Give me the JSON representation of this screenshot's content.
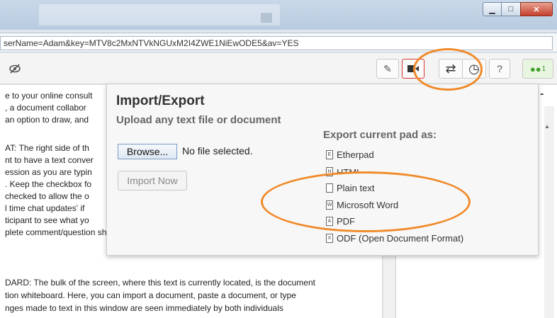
{
  "window": {
    "minimize_glyph": "▁",
    "maximize_glyph": "□",
    "close_glyph": "✕"
  },
  "address_bar": {
    "value": "serName=Adam&key=MTV8c2MxNTVkNGUxM2I4ZWE1NiEwODE5&av=YES"
  },
  "toolbar": {
    "left_icon": "eye-slash-icon",
    "buttons": [
      {
        "name": "pencil-icon",
        "glyph": "✎"
      },
      {
        "name": "video-icon",
        "glyph": "■"
      },
      {
        "name": "import-export-icon",
        "glyph": "⇄"
      },
      {
        "name": "history-icon",
        "glyph": "◷"
      },
      {
        "name": "help-icon",
        "glyph": "?"
      }
    ],
    "users": {
      "icon": "users-icon",
      "count": "1"
    }
  },
  "pad_lines": [
    "e to your online consult",
    ", a document collabor",
    "an option to draw, and",
    "",
    "AT: The right side of th",
    "nt to have a text conver",
    "ession as you are typin",
    ". Keep the checkbox fo",
    "checked to allow the o",
    "l time chat updates' if",
    "ticipant to see what yo",
    "plete comment/question show up in the chat column.",
    "",
    "DARD: The bulk of the screen, where this text is currently located, is the document",
    "tion whiteboard. Here, you can import a document, paste a document, or type",
    "nges made to text in this window are seen immediately by both individuals"
  ],
  "popup": {
    "title": "Import/Export",
    "subtitle": "Upload any text file or document",
    "browse_label": "Browse...",
    "file_status": "No file selected.",
    "import_button": "Import Now",
    "export_heading": "Export current pad as:",
    "export_options": [
      {
        "label": "Etherpad",
        "icon": "etherpad-file-icon",
        "glyph": "E"
      },
      {
        "label": "HTML",
        "icon": "html-file-icon",
        "glyph": "H"
      },
      {
        "label": "Plain text",
        "icon": "text-file-icon",
        "glyph": ""
      },
      {
        "label": "Microsoft Word",
        "icon": "word-file-icon",
        "glyph": "W"
      },
      {
        "label": "PDF",
        "icon": "pdf-file-icon",
        "glyph": "A"
      },
      {
        "label": "ODF (Open Document Format)",
        "icon": "odf-file-icon",
        "glyph": "X"
      }
    ]
  },
  "chat": {
    "collapse_label": "-"
  },
  "colors": {
    "annotation": "#f08a2a",
    "users_badge": "#6fbf4a",
    "video_border": "#d9342b"
  }
}
